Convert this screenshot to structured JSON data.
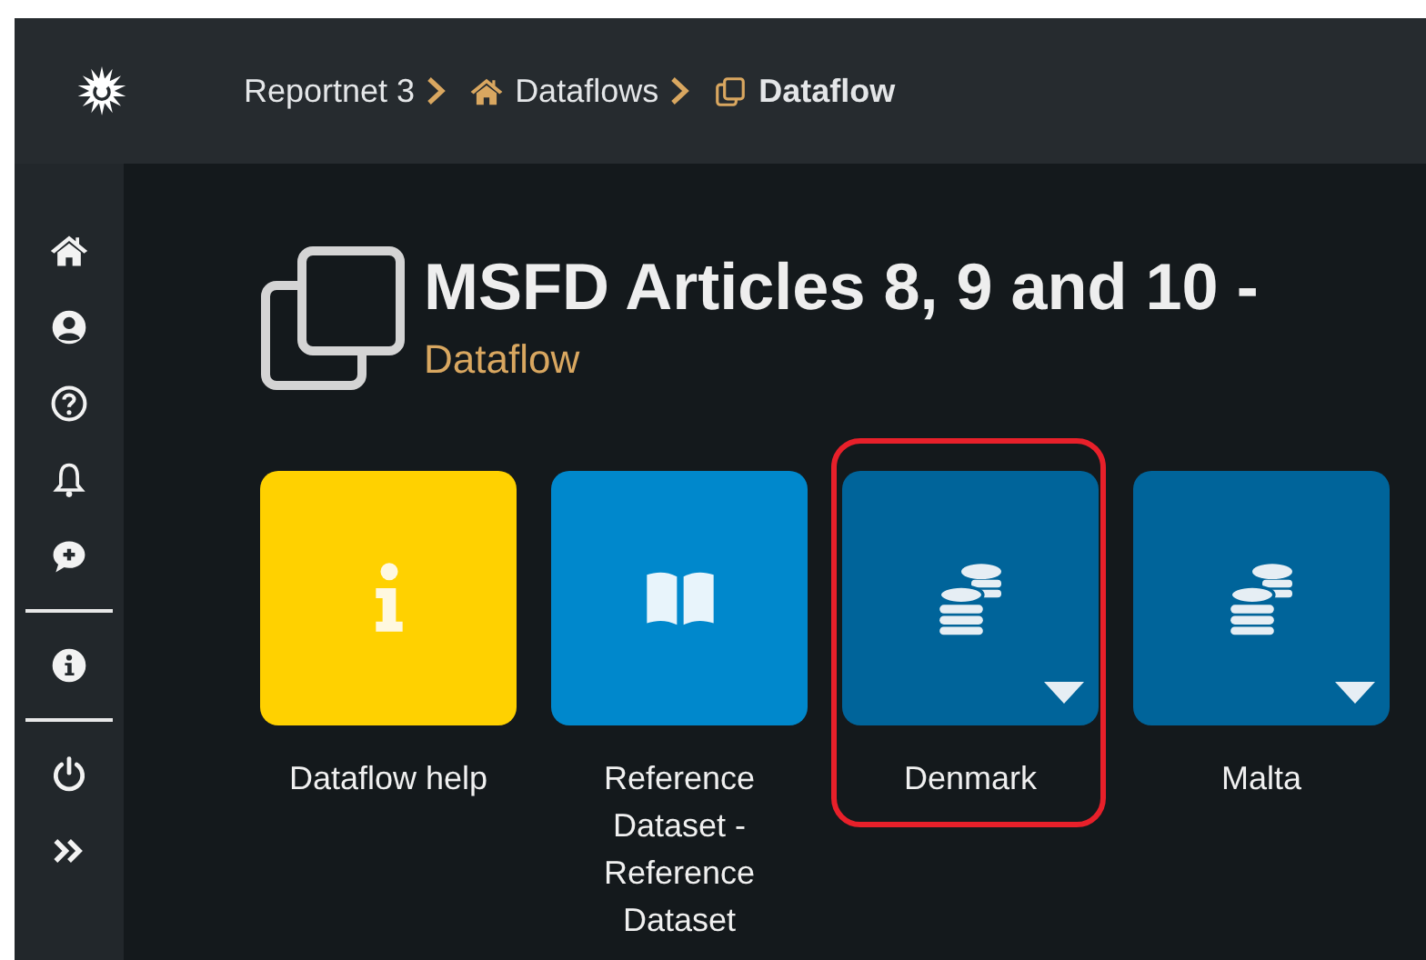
{
  "breadcrumb": [
    {
      "label": "Reportnet 3",
      "kind": "root"
    },
    {
      "label": "Dataflows",
      "kind": "home"
    },
    {
      "label": "Dataflow",
      "kind": "current"
    }
  ],
  "sidebar": {
    "items": [
      {
        "kind": "home"
      },
      {
        "kind": "user"
      },
      {
        "kind": "help"
      },
      {
        "kind": "bell"
      },
      {
        "kind": "chat"
      },
      {
        "kind": "divider"
      },
      {
        "kind": "info"
      },
      {
        "kind": "divider"
      },
      {
        "kind": "power"
      },
      {
        "kind": "expand"
      }
    ]
  },
  "title": "MSFD Articles 8, 9 and 10 -",
  "subtitle": "Dataflow",
  "cards": [
    {
      "label": "Dataflow help",
      "kind": "help",
      "highlighted": false
    },
    {
      "label": "Reference Dataset - Reference Dataset",
      "kind": "reference",
      "highlighted": false
    },
    {
      "label": "Denmark",
      "kind": "dataset",
      "highlighted": true
    },
    {
      "label": "Malta",
      "kind": "dataset",
      "highlighted": false
    }
  ]
}
